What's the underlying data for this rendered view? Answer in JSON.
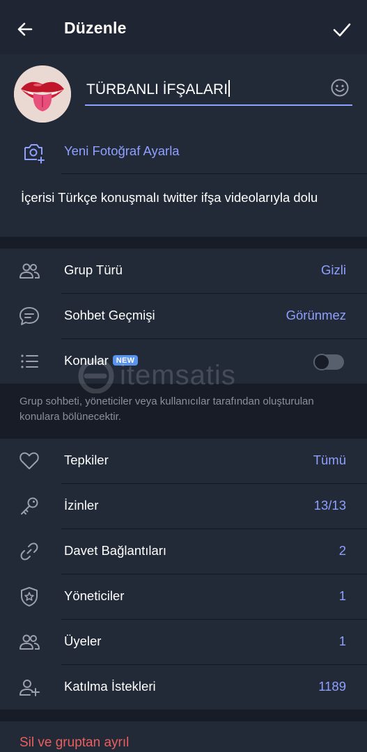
{
  "header": {
    "title": "Düzenle"
  },
  "group": {
    "name": "TÜRBANLI İFŞALARI",
    "set_photo_label": "Yeni Fotoğraf Ayarla"
  },
  "description": "İçerisi Türkçe konuşmalı twitter ifşa videolarıyla dolu",
  "settings": [
    {
      "label": "Grup Türü",
      "value": "Gizli",
      "icon": "group-icon"
    },
    {
      "label": "Sohbet Geçmişi",
      "value": "Görünmez",
      "icon": "chat-bubble-icon"
    },
    {
      "label": "Konular",
      "badge": "NEW",
      "icon": "list-icon",
      "toggle": false
    }
  ],
  "topics_hint": "Grup sohbeti, yöneticiler veya kullanıcılar tarafından oluşturulan konulara bölünecektir.",
  "manage": [
    {
      "label": "Tepkiler",
      "value": "Tümü",
      "icon": "heart-icon"
    },
    {
      "label": "İzinler",
      "value": "13/13",
      "icon": "key-icon"
    },
    {
      "label": "Davet Bağlantıları",
      "value": "2",
      "icon": "link-icon"
    },
    {
      "label": "Yöneticiler",
      "value": "1",
      "icon": "shield-star-icon"
    },
    {
      "label": "Üyeler",
      "value": "1",
      "icon": "members-icon"
    },
    {
      "label": "Katılma İstekleri",
      "value": "1189",
      "icon": "add-user-icon"
    }
  ],
  "danger_action": "Sil ve gruptan ayrıl",
  "watermark": "itemsatis",
  "colors": {
    "accent": "#8fa0ff",
    "danger": "#ec5f5f",
    "background": "#171c26",
    "card": "#222937",
    "header": "#1f2533"
  }
}
